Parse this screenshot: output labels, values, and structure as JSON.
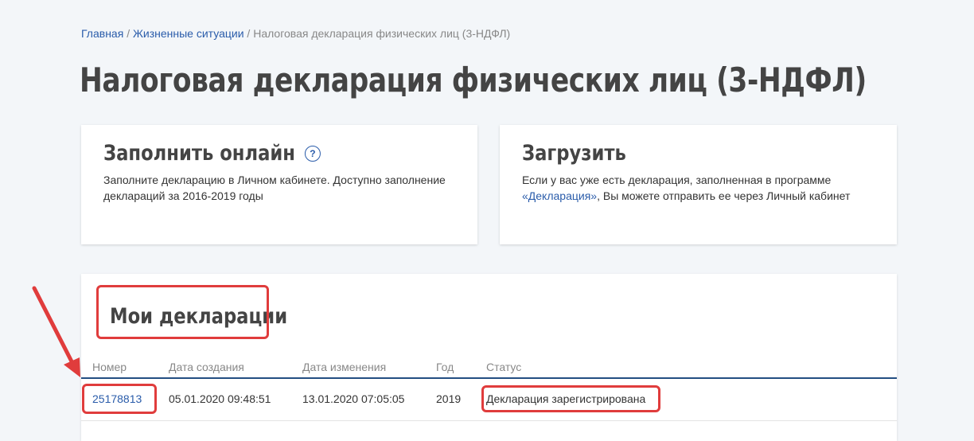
{
  "breadcrumb": {
    "items": [
      "Главная",
      "Жизненные ситуации"
    ],
    "current": "Налоговая декларация физических лиц (3-НДФЛ)",
    "separator": "/"
  },
  "page_title": "Налоговая декларация физических лиц (3-НДФЛ)",
  "cards": {
    "online": {
      "title": "Заполнить онлайн",
      "help_icon": "?",
      "text": "Заполните декларацию в Личном кабинете. Доступно заполнение деклараций за 2016-2019 годы"
    },
    "upload": {
      "title": "Загрузить",
      "text_before": "Если у вас уже есть декларация, заполненная в программе ",
      "link": "«Декларация»",
      "text_after": ", Вы можете отправить ее через Личный кабинет"
    }
  },
  "declarations": {
    "title": "Мои декларации",
    "columns": [
      "Номер",
      "Дата создания",
      "Дата изменения",
      "Год",
      "Статус"
    ],
    "rows": [
      {
        "number": "25178813",
        "created": "05.01.2020 09:48:51",
        "modified": "13.01.2020 07:05:05",
        "year": "2019",
        "status": "Декларация зарегистрирована"
      }
    ]
  },
  "colors": {
    "link": "#2a5caa",
    "highlight": "#e03c3c",
    "table_header_line": "#234e82",
    "background": "#f3f6f9"
  }
}
